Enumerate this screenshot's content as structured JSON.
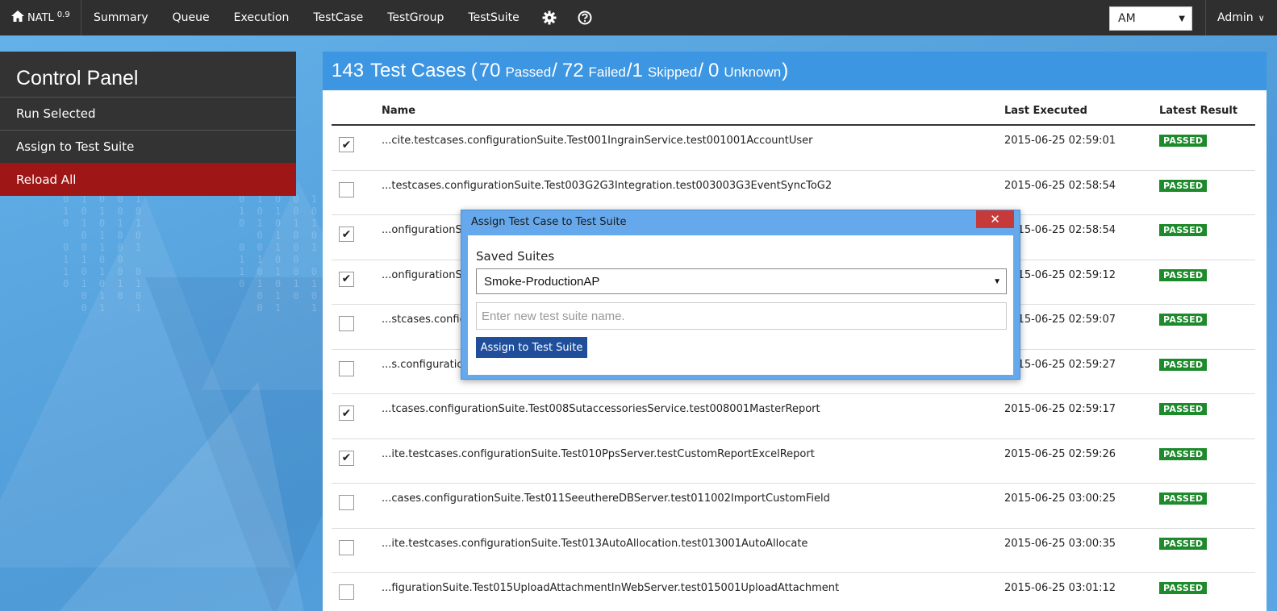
{
  "colors": {
    "navbar": "#2f2f2f",
    "panel_header": "#3d96e2",
    "danger": "#9e1616",
    "passed_badge": "#1d8a2b",
    "modal_button": "#1f4f9b",
    "modal_close": "#c73a3a"
  },
  "navbar": {
    "brand": "NATL",
    "version": "0.9",
    "home_icon": "home-icon",
    "items": [
      "Summary",
      "Queue",
      "Execution",
      "TestCase",
      "TestGroup",
      "TestSuite"
    ],
    "settings_icon": "gear-icon",
    "help_icon": "help-circle-icon",
    "environment_select": "AM",
    "user": "Admin"
  },
  "control_panel": {
    "title": "Control Panel",
    "items": [
      "Run Selected",
      "Assign to Test Suite",
      "Reload All"
    ]
  },
  "summary": {
    "total": "143",
    "total_label": "Test Cases",
    "passed": "70",
    "passed_label": "Passed",
    "failed": "72",
    "failed_label": "Failed",
    "skipped": "1",
    "skipped_label": "Skipped",
    "unknown": "0",
    "unknown_label": "Unknown"
  },
  "table": {
    "columns": [
      "Name",
      "Last Executed",
      "Latest Result"
    ],
    "rows": [
      {
        "checked": true,
        "name": "...cite.testcases.configurationSuite.Test001IngrainService.test001001AccountUser",
        "date": "2015-06-25 02:59:01",
        "result": "PASSED"
      },
      {
        "checked": false,
        "name": "...testcases.configurationSuite.Test003G2G3Integration.test003003G3EventSyncToG2",
        "date": "2015-06-25 02:58:54",
        "result": "PASSED"
      },
      {
        "checked": true,
        "name": "...onfigurationSu",
        "date": "2015-06-25 02:58:54",
        "result": "PASSED"
      },
      {
        "checked": true,
        "name": "...onfigurationSu",
        "date": "2015-06-25 02:59:12",
        "result": "PASSED"
      },
      {
        "checked": false,
        "name": "...stcases.configu",
        "date": "2015-06-25 02:59:07",
        "result": "PASSED"
      },
      {
        "checked": false,
        "name": "...s.configuration",
        "date": "2015-06-25 02:59:27",
        "result": "PASSED"
      },
      {
        "checked": true,
        "name": "...tcases.configurationSuite.Test008SutaccessoriesService.test008001MasterReport",
        "date": "2015-06-25 02:59:17",
        "result": "PASSED"
      },
      {
        "checked": true,
        "name": "...ite.testcases.configurationSuite.Test010PpsServer.testCustomReportExcelReport",
        "date": "2015-06-25 02:59:26",
        "result": "PASSED"
      },
      {
        "checked": false,
        "name": "...cases.configurationSuite.Test011SeeuthereDBServer.test011002ImportCustomField",
        "date": "2015-06-25 03:00:25",
        "result": "PASSED"
      },
      {
        "checked": false,
        "name": "...ite.testcases.configurationSuite.Test013AutoAllocation.test013001AutoAllocate",
        "date": "2015-06-25 03:00:35",
        "result": "PASSED"
      },
      {
        "checked": false,
        "name": "...figurationSuite.Test015UploadAttachmentInWebServer.test015001UploadAttachment",
        "date": "2015-06-25 03:01:12",
        "result": "PASSED"
      }
    ]
  },
  "modal": {
    "title": "Assign Test Case to Test Suite",
    "close": "✕",
    "saved_suites_label": "Saved Suites",
    "saved_suites_value": "Smoke-ProductionAP",
    "new_suite_placeholder": "Enter new test suite name.",
    "submit": "Assign to Test Suite"
  }
}
